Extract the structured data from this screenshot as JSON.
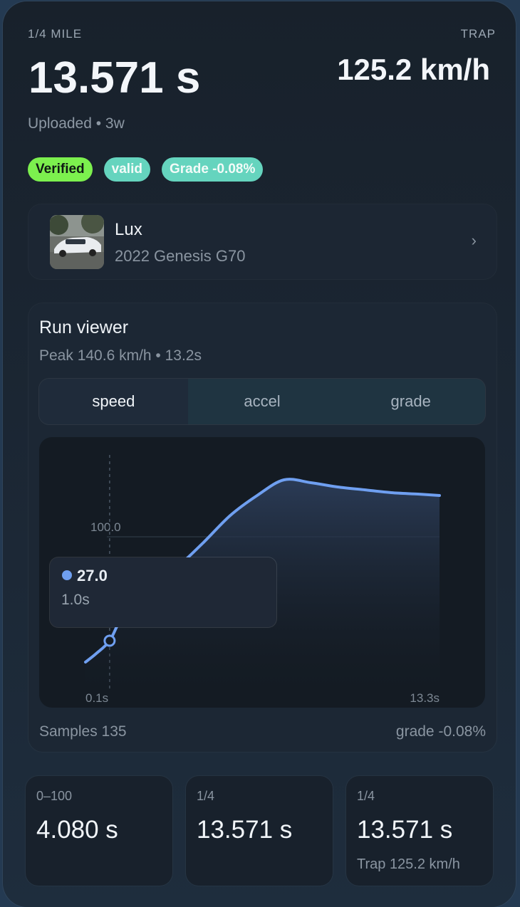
{
  "header": {
    "distance_label": "1/4 MILE",
    "time": "13.571 s",
    "trap_label": "TRAP",
    "trap_speed": "125.2 km/h",
    "uploaded": "Uploaded • 3w"
  },
  "badges": {
    "verified": "Verified",
    "valid": "valid",
    "grade": "Grade -0.08%"
  },
  "colors": {
    "verified": "#7cf04e",
    "valid": "#65d4be",
    "curve": "#6f9ff0"
  },
  "car": {
    "name": "Lux",
    "model": "2022 Genesis G70",
    "chevron": "›"
  },
  "viewer": {
    "title": "Run viewer",
    "subtitle": "Peak 140.6 km/h • 13.2s",
    "tabs": [
      "speed",
      "accel",
      "grade"
    ],
    "active_tab": "speed",
    "samples": "Samples 135",
    "grade": "grade -0.08%",
    "tooltip": {
      "value": "27.0",
      "time": "1.0s"
    }
  },
  "chart_data": {
    "type": "area",
    "series": [
      {
        "x": [
          0.1,
          0.5,
          1.0,
          1.5,
          2.5,
          3.5,
          4.5,
          5.5,
          6.5,
          7.5,
          8.5,
          9.5,
          10.5,
          11.5,
          12.5,
          13.3
        ],
        "values": [
          12,
          18,
          27,
          44,
          61,
          78,
          96,
          115,
          129,
          140,
          138,
          135,
          133,
          131,
          130,
          129
        ]
      }
    ],
    "gridline": 100.0,
    "gridline_label": "100.0",
    "x_tick_labels": [
      "0.1s",
      "13.3s"
    ],
    "xlim": [
      0.1,
      13.3
    ],
    "ylim": [
      0,
      150
    ],
    "marker_x": 1.0,
    "peak_value": 140.6,
    "peak_time": 13.2
  },
  "stats": [
    {
      "label": "0–100",
      "value": "4.080 s",
      "sub": ""
    },
    {
      "label": "1/4",
      "value": "13.571 s",
      "sub": ""
    },
    {
      "label": "1/4",
      "value": "13.571 s",
      "sub": "Trap 125.2 km/h"
    }
  ]
}
